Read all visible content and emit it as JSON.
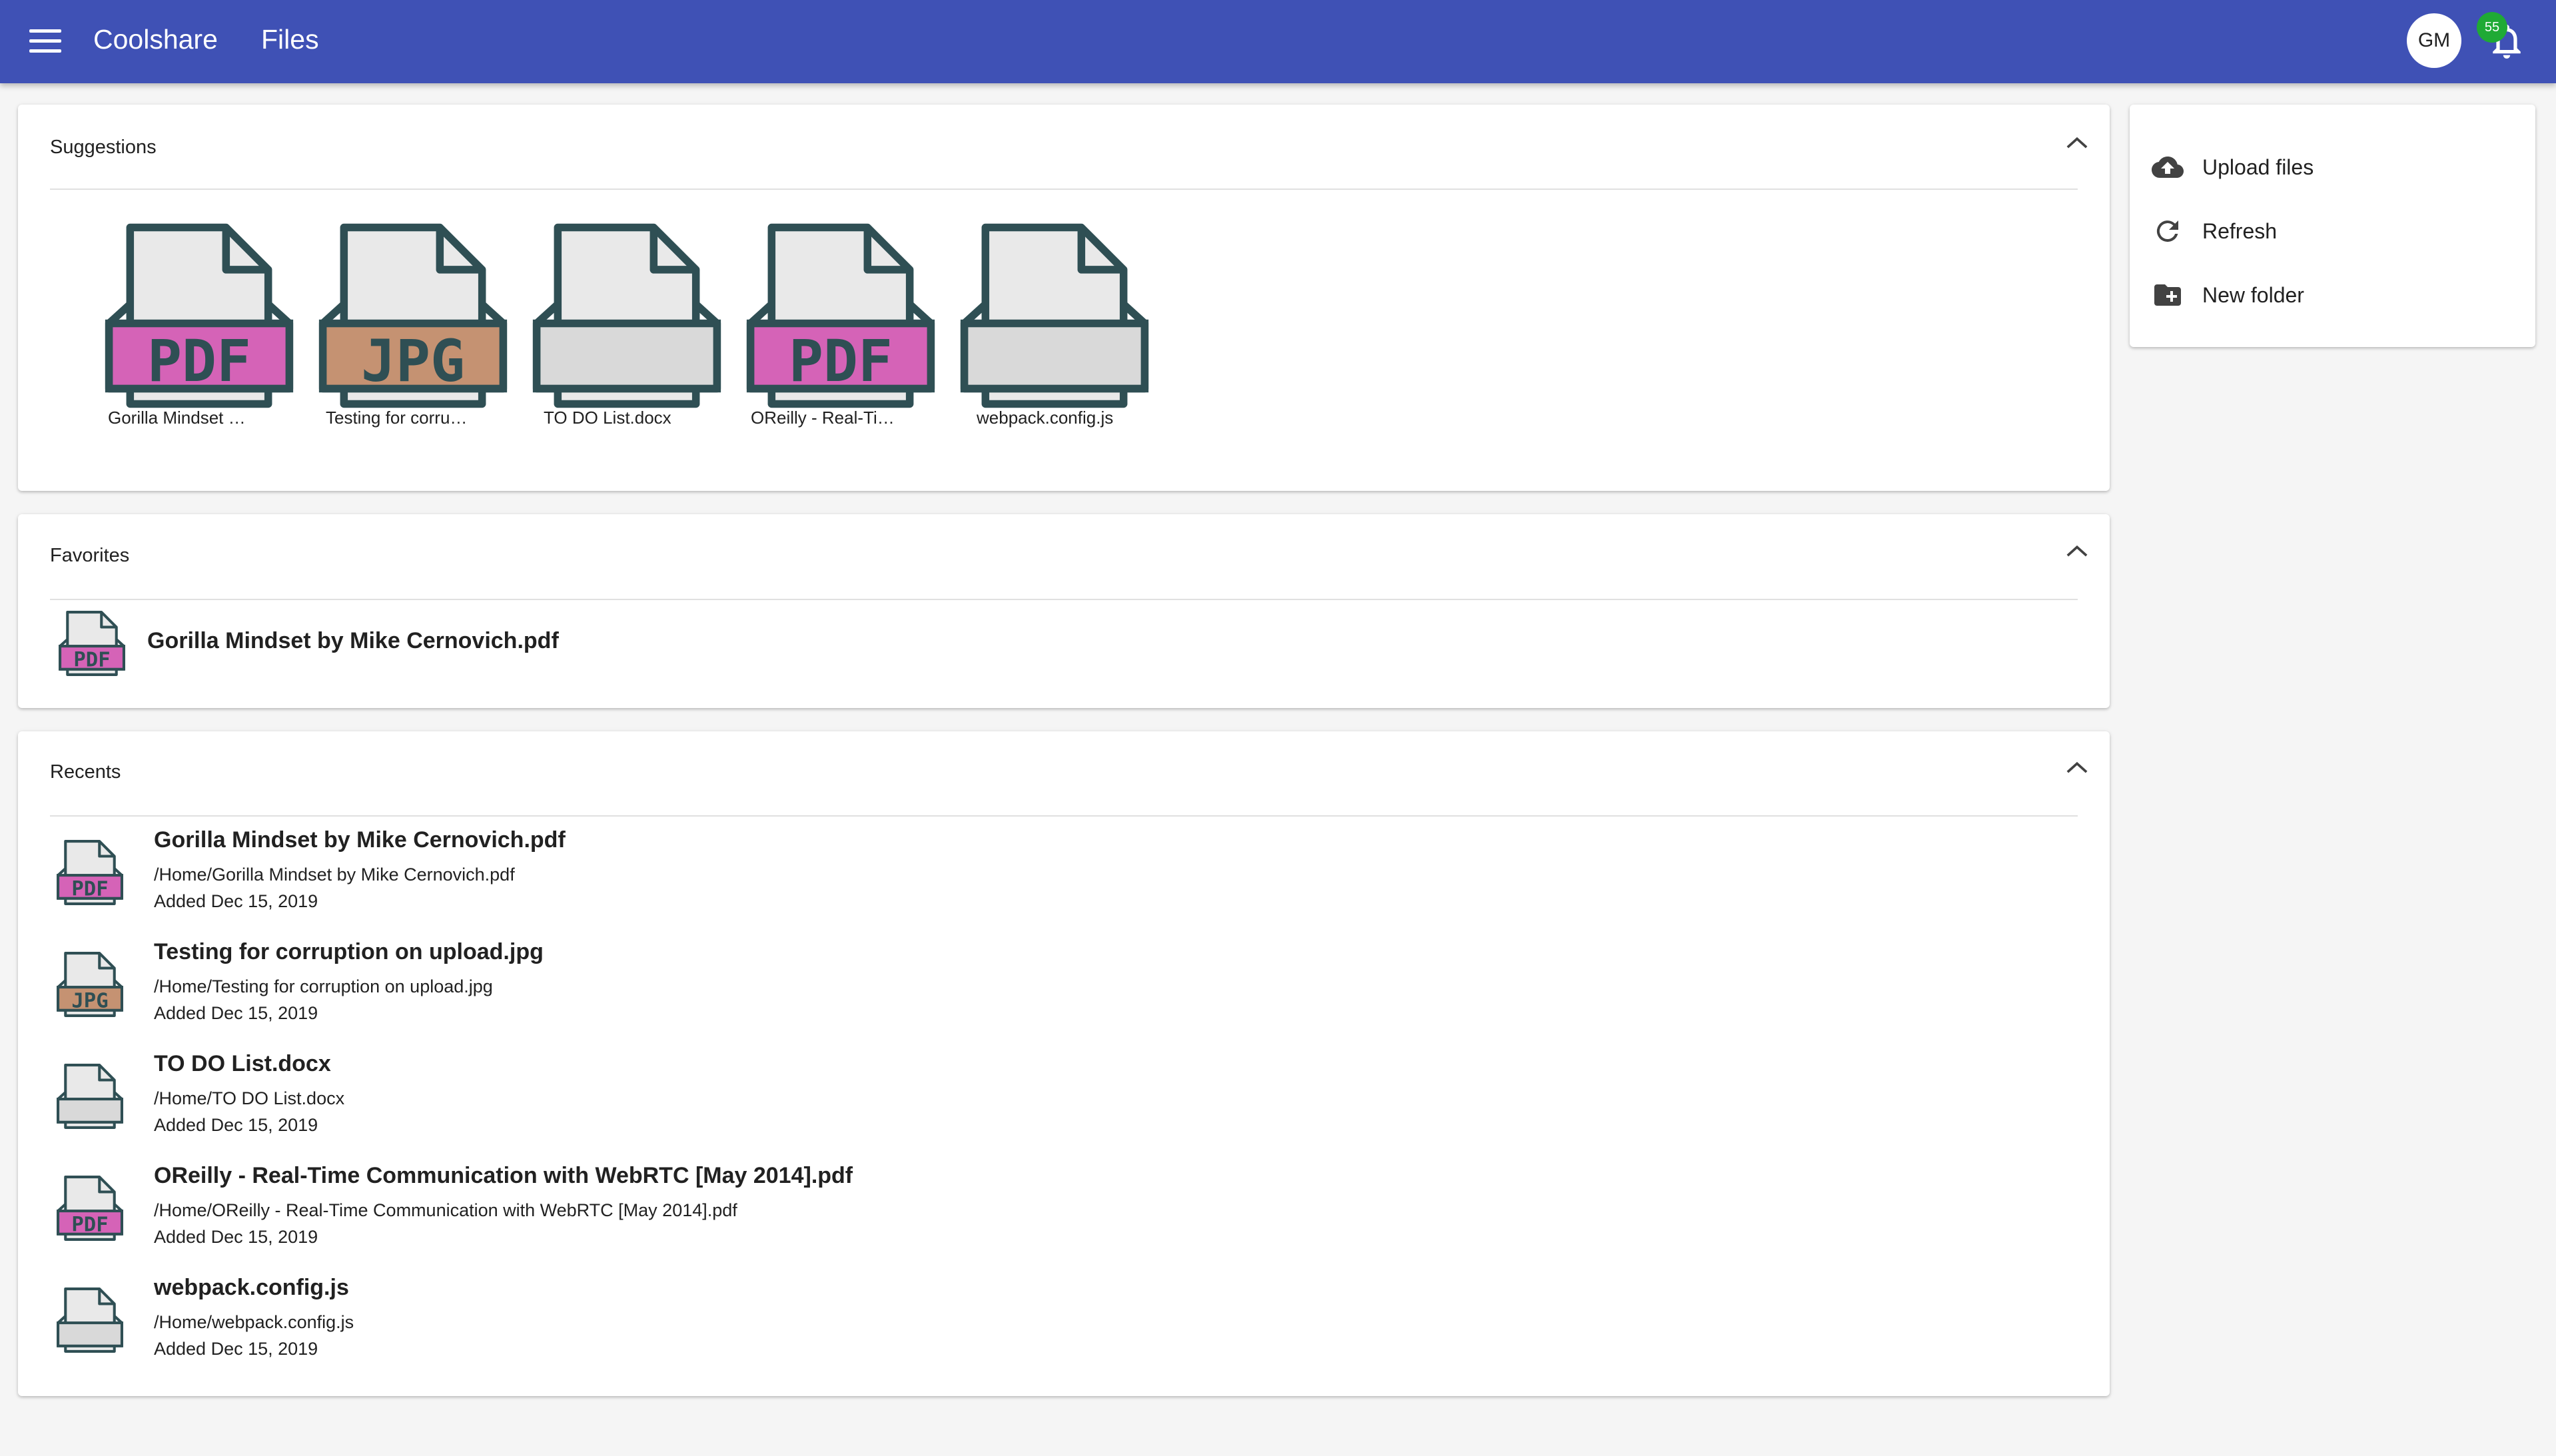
{
  "app_bar": {
    "brand": "Coolshare",
    "section": "Files",
    "avatar_initials": "GM",
    "notification_count": "55",
    "color": "#3f51b5"
  },
  "suggestions": {
    "title": "Suggestions",
    "items": [
      {
        "label": "Gorilla Mindset …",
        "type": "PDF"
      },
      {
        "label": "Testing for corru…",
        "type": "JPG"
      },
      {
        "label": "TO DO List.docx",
        "type": ""
      },
      {
        "label": "OReilly - Real-Ti…",
        "type": "PDF"
      },
      {
        "label": "webpack.config.js",
        "type": ""
      }
    ]
  },
  "favorites": {
    "title": "Favorites",
    "items": [
      {
        "name": "Gorilla Mindset by Mike Cernovich.pdf",
        "type": "PDF"
      }
    ]
  },
  "recents": {
    "title": "Recents",
    "items": [
      {
        "name": "Gorilla Mindset by Mike Cernovich.pdf",
        "path": "/Home/Gorilla Mindset by Mike Cernovich.pdf",
        "added": "Added Dec 15, 2019",
        "type": "PDF"
      },
      {
        "name": "Testing for corruption on upload.jpg",
        "path": "/Home/Testing for corruption on upload.jpg",
        "added": "Added Dec 15, 2019",
        "type": "JPG"
      },
      {
        "name": "TO DO List.docx",
        "path": "/Home/TO DO List.docx",
        "added": "Added Dec 15, 2019",
        "type": ""
      },
      {
        "name": "OReilly - Real-Time Communication with WebRTC [May 2014].pdf",
        "path": "/Home/OReilly - Real-Time Communication with WebRTC [May 2014].pdf",
        "added": "Added Dec 15, 2019",
        "type": "PDF"
      },
      {
        "name": "webpack.config.js",
        "path": "/Home/webpack.config.js",
        "added": "Added Dec 15, 2019",
        "type": ""
      }
    ]
  },
  "actions": [
    {
      "label": "Upload files",
      "icon": "cloud-upload-icon"
    },
    {
      "label": "Refresh",
      "icon": "refresh-icon"
    },
    {
      "label": "New folder",
      "icon": "new-folder-icon"
    }
  ],
  "colors": {
    "pdf_band": "#d563b7",
    "jpg_band": "#c59272",
    "blank_band": "#d9d9d9",
    "icon_stroke": "#2f4f54",
    "icon_fill": "#e9e9e9",
    "badge": "#1faa35"
  }
}
